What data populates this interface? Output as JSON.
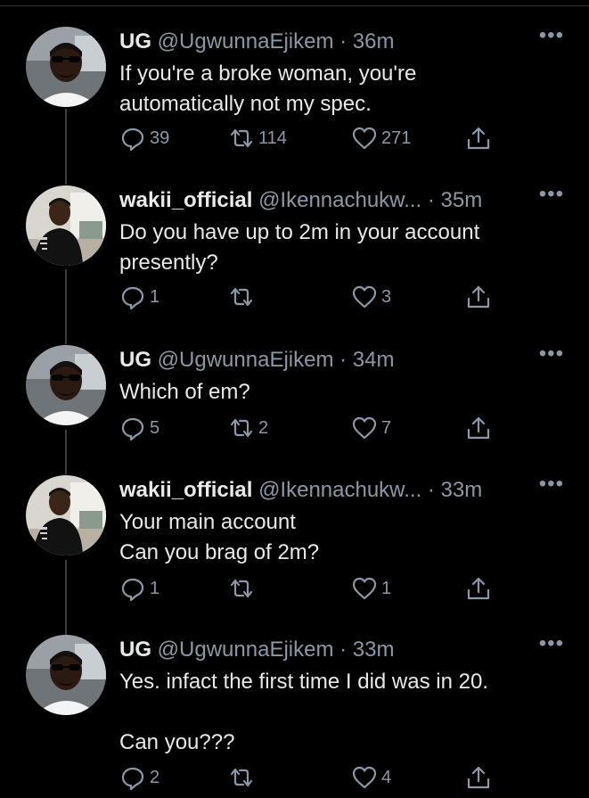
{
  "tweets": [
    {
      "name": "UG",
      "handle": "@UgwunnaEjikem",
      "time": "36m",
      "more": "•••",
      "lines": [
        "If you're a broke woman, you're",
        "automatically not my spec."
      ],
      "replies": "39",
      "retweets": "114",
      "likes": "271",
      "avatar": "ug-avatar"
    },
    {
      "name": "wakii_official",
      "handle": "@Ikennachukw...",
      "time": "35m",
      "more": "•••",
      "lines": [
        "Do you have up to 2m in your account",
        "presently?"
      ],
      "replies": "1",
      "retweets": "",
      "likes": "3",
      "avatar": "wakii-avatar"
    },
    {
      "name": "UG",
      "handle": "@UgwunnaEjikem",
      "time": "34m",
      "more": "•••",
      "lines": [
        "Which of em?"
      ],
      "replies": "5",
      "retweets": "2",
      "likes": "7",
      "avatar": "ug-avatar"
    },
    {
      "name": "wakii_official",
      "handle": "@Ikennachukw...",
      "time": "33m",
      "more": "•••",
      "lines": [
        "Your main account",
        "Can you brag of 2m?"
      ],
      "replies": "1",
      "retweets": "",
      "likes": "1",
      "avatar": "wakii-avatar"
    },
    {
      "name": "UG",
      "handle": "@UgwunnaEjikem",
      "time": "33m",
      "more": "•••",
      "lines": [
        "Yes. infact the first time I did was in 20.",
        "",
        "Can you???"
      ],
      "replies": "2",
      "retweets": "",
      "likes": "4",
      "avatar": "ug-avatar"
    }
  ],
  "colors": {
    "background": "#000000",
    "text": "#e7e9ea",
    "muted": "#8b98a5",
    "thread_line": "#3a3d40"
  }
}
